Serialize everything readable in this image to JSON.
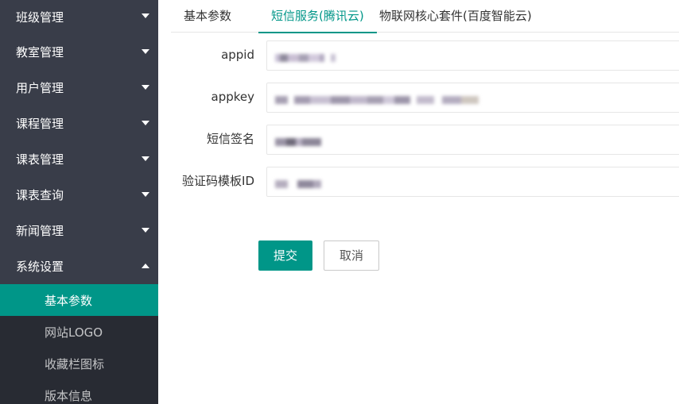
{
  "sidebar": {
    "items": [
      {
        "label": "班级管理",
        "expanded": false
      },
      {
        "label": "教室管理",
        "expanded": false
      },
      {
        "label": "用户管理",
        "expanded": false
      },
      {
        "label": "课程管理",
        "expanded": false
      },
      {
        "label": "课表管理",
        "expanded": false
      },
      {
        "label": "课表查询",
        "expanded": false
      },
      {
        "label": "新闻管理",
        "expanded": false
      },
      {
        "label": "系统设置",
        "expanded": true
      }
    ],
    "sub_items": [
      {
        "label": "基本参数",
        "active": true
      },
      {
        "label": "网站LOGO",
        "active": false
      },
      {
        "label": "收藏栏图标",
        "active": false
      },
      {
        "label": "版本信息",
        "active": false
      }
    ]
  },
  "tabs": [
    {
      "label": "基本参数",
      "active": false
    },
    {
      "label": "短信服务(腾讯云)",
      "active": true
    },
    {
      "label": "物联网核心套件(百度智能云)",
      "active": false
    }
  ],
  "form": {
    "fields": [
      {
        "label": "appid"
      },
      {
        "label": "appkey"
      },
      {
        "label": "短信签名"
      },
      {
        "label": "验证码模板ID"
      }
    ],
    "submit_label": "提交",
    "cancel_label": "取消"
  },
  "colors": {
    "accent": "#009688",
    "sidebar_bg": "#393d49",
    "subnav_bg": "#282b33"
  }
}
